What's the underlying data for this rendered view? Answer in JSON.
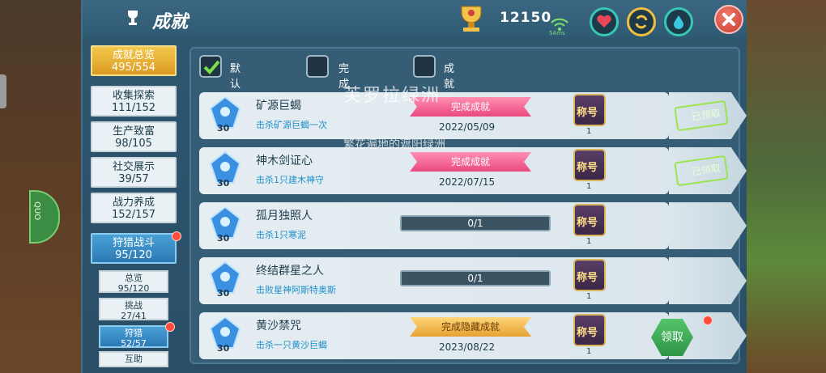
{
  "header": {
    "title": "成就",
    "score": "12150",
    "wifi_label": "5Ams"
  },
  "nav": [
    {
      "label": "成就总览",
      "count": "495/554"
    },
    {
      "label": "收集探索",
      "count": "111/152"
    },
    {
      "label": "生产致富",
      "count": "98/105"
    },
    {
      "label": "社交展示",
      "count": "39/57"
    },
    {
      "label": "战力养成",
      "count": "152/157"
    },
    {
      "label": "狩猎战斗",
      "count": "95/120"
    }
  ],
  "subnav": [
    {
      "label": "总览",
      "count": "95/120"
    },
    {
      "label": "挑战",
      "count": "27/41"
    },
    {
      "label": "狩猎",
      "count": "52/57"
    },
    {
      "label": "互助",
      "count": ""
    }
  ],
  "sort": {
    "default": "默认排序",
    "completion": "完成度排序",
    "points": "成就点排序"
  },
  "watermark": {
    "line1": "芙罗拉绿洲",
    "line2": "繁花遍地的遮阳绿洲"
  },
  "achievements": [
    {
      "name": "矿源巨蝎",
      "desc": "击杀矿源巨蝎一次",
      "points": "30",
      "status": "完成成就",
      "date": "2022/05/09",
      "title_label": "称号",
      "title_count": "1",
      "claim": "已领取"
    },
    {
      "name": "神木剑证心",
      "desc": "击杀1只建木神守",
      "points": "30",
      "status": "完成成就",
      "date": "2022/07/15",
      "title_label": "称号",
      "title_count": "1",
      "claim": "已领取"
    },
    {
      "name": "孤月独照人",
      "desc": "击杀1只寒泥",
      "points": "30",
      "progress": "0/1",
      "title_label": "称号",
      "title_count": "1"
    },
    {
      "name": "终结群星之人",
      "desc": "击败星神阿斯特奥斯",
      "points": "30",
      "progress": "0/1",
      "title_label": "称号",
      "title_count": "1"
    },
    {
      "name": "黄沙禁咒",
      "desc": "击杀一只黄沙巨蝎",
      "points": "30",
      "status": "完成隐藏成就",
      "date": "2023/08/22",
      "title_label": "称号",
      "title_count": "1",
      "claim": "领取"
    }
  ],
  "side_pill": "QUO"
}
